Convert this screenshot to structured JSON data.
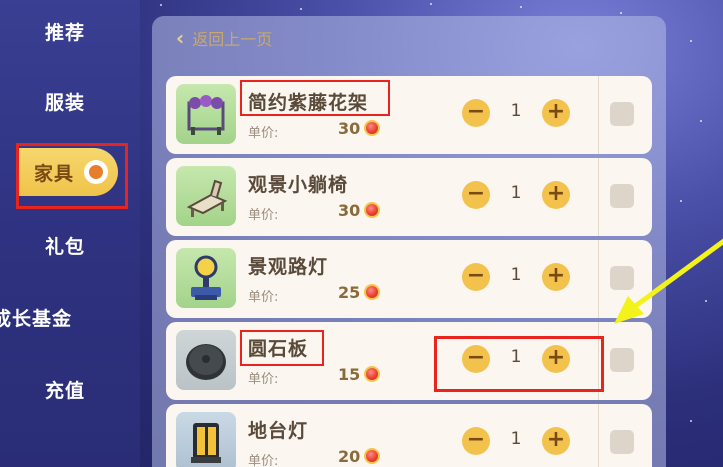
{
  "sidebar": {
    "items": [
      {
        "label": "推荐"
      },
      {
        "label": "服装"
      },
      {
        "label": "家具"
      },
      {
        "label": "礼包"
      },
      {
        "label": "成长基金"
      },
      {
        "label": "充值"
      }
    ],
    "active_index": 2
  },
  "panel": {
    "back_label": "返回上一页"
  },
  "items": [
    {
      "name": "简约紫藤花架",
      "price_label": "单价:",
      "price": "30",
      "qty": "1",
      "checked": false
    },
    {
      "name": "观景小躺椅",
      "price_label": "单价:",
      "price": "30",
      "qty": "1",
      "checked": false
    },
    {
      "name": "景观路灯",
      "price_label": "单价:",
      "price": "25",
      "qty": "1",
      "checked": false
    },
    {
      "name": "圆石板",
      "price_label": "单价:",
      "price": "15",
      "qty": "1",
      "checked": false
    },
    {
      "name": "地台灯",
      "price_label": "单价:",
      "price": "20",
      "qty": "1",
      "checked": false
    }
  ],
  "stepper": {
    "minus": "−",
    "plus": "+"
  },
  "icons": {
    "back": "chevron-left-icon",
    "currency": "coin-icon",
    "active_badge": "paw-badge-icon"
  },
  "colors": {
    "accent_gold": "#f2c24d",
    "annotation_red": "#e8241f",
    "annotation_arrow": "#f3f21a"
  }
}
